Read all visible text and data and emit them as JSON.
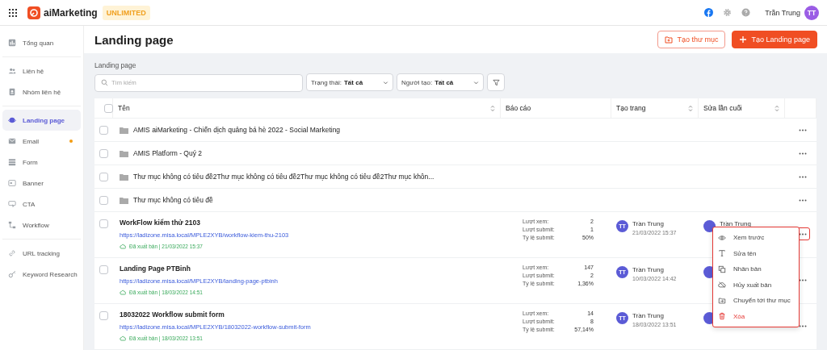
{
  "topbar": {
    "logo_text": "aiMarketing",
    "plan_badge": "UNLIMITED",
    "user_name": "Trần Trung",
    "avatar_initials": "TT"
  },
  "sidebar": {
    "groups": [
      [
        {
          "label": "Tổng quan",
          "selected": false,
          "notification": false
        }
      ],
      [
        {
          "label": "Liên hệ",
          "selected": false,
          "notification": false
        },
        {
          "label": "Nhóm liên hệ",
          "selected": false,
          "notification": false
        }
      ],
      [
        {
          "label": "Landing page",
          "selected": true,
          "notification": false
        },
        {
          "label": "Email",
          "selected": false,
          "notification": true
        },
        {
          "label": "Form",
          "selected": false,
          "notification": false
        },
        {
          "label": "Banner",
          "selected": false,
          "notification": false
        },
        {
          "label": "CTA",
          "selected": false,
          "notification": false
        },
        {
          "label": "Workflow",
          "selected": false,
          "notification": false
        }
      ],
      [
        {
          "label": "URL tracking",
          "selected": false,
          "notification": false
        },
        {
          "label": "Keyword Research",
          "selected": false,
          "notification": false
        }
      ]
    ]
  },
  "page": {
    "title": "Landing page",
    "buttons": [
      {
        "label": "Tạo thư mục",
        "kind": "outline"
      },
      {
        "label": "Tạo Landing page",
        "kind": "primary"
      }
    ],
    "breadcrumb": "Landing page"
  },
  "filters": {
    "search": {
      "placeholder": "Tìm kiếm"
    },
    "dropdowns": [
      {
        "label": "Trạng thái:",
        "value": "Tất cả"
      },
      {
        "label": "Người tạo:",
        "value": "Tất cả"
      }
    ]
  },
  "table": {
    "select_all_checked": false,
    "columns": [
      {
        "label": "Tên",
        "sortable": true
      },
      {
        "label": "Báo cáo",
        "sortable": false
      },
      {
        "label": "Tạo trang",
        "sortable": true
      },
      {
        "label": "Sửa lần cuối",
        "sortable": true
      }
    ],
    "rows": [
      {
        "kind": "folder",
        "name": "AMIS aiMarketing - Chiến dịch quảng bá hè 2022 - Social Marketing",
        "checked": false,
        "menu_open": false
      },
      {
        "kind": "folder",
        "name": "AMIS Platform - Quý 2",
        "checked": false,
        "menu_open": false
      },
      {
        "kind": "folder",
        "name": "Thư mục không có tiêu đề2Thư mục không có tiêu đề2Thư mục không có tiêu đề2Thư mục khôn...",
        "checked": false,
        "menu_open": false
      },
      {
        "kind": "folder",
        "name": "Thư mục không có tiêu đề",
        "checked": false,
        "menu_open": false
      },
      {
        "kind": "page",
        "name": "WorkFlow kiểm thử 2103",
        "url": "https://ladizone.misa.local/MPLE2XYB/workflow-kiem-thu-2103",
        "status": "Đã xuất bản | 21/03/2022 15:37",
        "stats": [
          {
            "label": "Lượt xem:",
            "value": "2"
          },
          {
            "label": "Lượt submit:",
            "value": "1"
          },
          {
            "label": "Tỷ lệ submit:",
            "value": "50%"
          }
        ],
        "creator": {
          "initials": "TT",
          "name": "Trần Trung",
          "date": "21/03/2022 15:37"
        },
        "editor_name": "Trần Trung",
        "checked": false,
        "menu_open": true
      },
      {
        "kind": "page",
        "name": "Landing Page PTBinh",
        "url": "https://ladizone.misa.local/MPLE2XYB/landing-page-ptbinh",
        "status": "Đã xuất bản | 18/03/2022 14:51",
        "stats": [
          {
            "label": "Lượt xem:",
            "value": "147"
          },
          {
            "label": "Lượt submit:",
            "value": "2"
          },
          {
            "label": "Tỷ lệ submit:",
            "value": "1,36%"
          }
        ],
        "creator": {
          "initials": "TT",
          "name": "Trần Trung",
          "date": "10/03/2022 14:42"
        },
        "checked": false,
        "menu_open": false
      },
      {
        "kind": "page",
        "name": "18032022 Workflow submit form",
        "url": "https://ladizone.misa.local/MPLE2XYB/18032022-workflow-submit-form",
        "status": "Đã xuất bản | 18/03/2022 13:51",
        "stats": [
          {
            "label": "Lượt xem:",
            "value": "14"
          },
          {
            "label": "Lượt submit:",
            "value": "8"
          },
          {
            "label": "Tỷ lệ submit:",
            "value": "57,14%"
          }
        ],
        "creator": {
          "initials": "TT",
          "name": "Trần Trung",
          "date": "18/03/2022 13:51"
        },
        "checked": false,
        "menu_open": false
      }
    ]
  },
  "context_menu": {
    "items": [
      {
        "label": "Xem trước",
        "kind": "normal"
      },
      {
        "label": "Sửa tên",
        "kind": "normal"
      },
      {
        "label": "Nhân bản",
        "kind": "normal"
      },
      {
        "label": "Hủy xuất bản",
        "kind": "normal"
      },
      {
        "label": "Chuyển tới thư mục",
        "kind": "normal"
      },
      {
        "label": "Xóa",
        "kind": "danger"
      }
    ]
  }
}
